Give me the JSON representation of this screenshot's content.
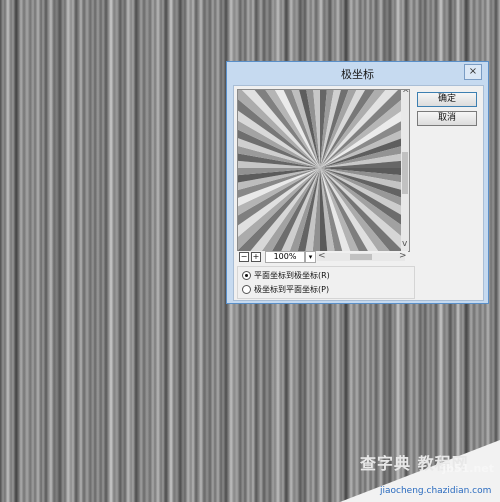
{
  "dialog": {
    "title": "极坐标",
    "close_label": "×",
    "ok_label": "确定",
    "cancel_label": "取消",
    "zoom": {
      "minus_label": "−",
      "plus_label": "+",
      "value": "100%",
      "dropdown_label": "▾",
      "scroll_left": "<",
      "scroll_right": ">"
    },
    "vscroll": {
      "up": "^",
      "down": "v"
    },
    "options": [
      {
        "label": "平面坐标到极坐标(R)",
        "checked": true
      },
      {
        "label": "极坐标到平面坐标(P)",
        "checked": false
      }
    ]
  },
  "watermark": {
    "text_cn": "查字典 教程网",
    "site": "jb51.net",
    "url": "jiaocheng.chazidian.com"
  },
  "colors": {
    "dialog_bg": "#c6daf0",
    "dialog_border": "#5a8fc8",
    "client_bg": "#f0f0f0",
    "default_button_border": "#3c7fb1",
    "watermark_url": "#2a6bbf"
  },
  "icons": [
    "close-icon",
    "zoom-out-icon",
    "zoom-in-icon",
    "dropdown-arrow-icon",
    "radio-icon"
  ]
}
